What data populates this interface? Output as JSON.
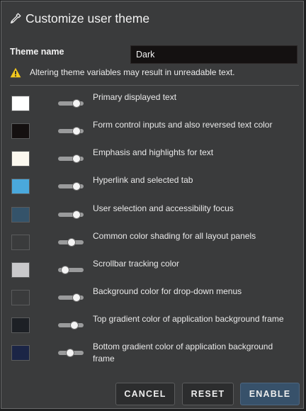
{
  "dialog": {
    "title": "Customize user theme",
    "title_icon": "eyedropper-icon"
  },
  "theme_name": {
    "label": "Theme name",
    "value": "Dark"
  },
  "warning": {
    "icon": "warning-triangle-icon",
    "text": "Altering theme variables may result in unreadable text."
  },
  "colors": {
    "warning": "#f2c81e",
    "primary_button": "#37516a",
    "background": "#3a3b3c"
  },
  "variables": [
    {
      "label": "Primary displayed text",
      "color": "#ffffff",
      "slider": 0.85
    },
    {
      "label": "Form control inputs and also reversed text color",
      "color": "#141010",
      "slider": 0.85
    },
    {
      "label": "Emphasis and highlights for text",
      "color": "#fbf8ef",
      "slider": 0.85
    },
    {
      "label": "Hyperlink and selected tab",
      "color": "#4aa8dc",
      "slider": 0.85
    },
    {
      "label": "User selection and accessibility focus",
      "color": "#34536a",
      "slider": 0.85
    },
    {
      "label": "Common color shading for all layout panels",
      "color": "#3a3b3c",
      "slider": 0.55
    },
    {
      "label": "Scrollbar tracking color",
      "color": "#c9c9cb",
      "slider": 0.18
    },
    {
      "label": "Background color for drop-down menus",
      "color": "#3a3b3c",
      "slider": 0.85
    },
    {
      "label": "Top gradient color of application background frame",
      "color": "#1d2025",
      "slider": 0.7
    },
    {
      "label": "Bottom gradient color of application background frame",
      "color": "#1b2546",
      "slider": 0.45
    }
  ],
  "buttons": {
    "cancel": "CANCEL",
    "reset": "RESET",
    "enable": "ENABLE"
  }
}
